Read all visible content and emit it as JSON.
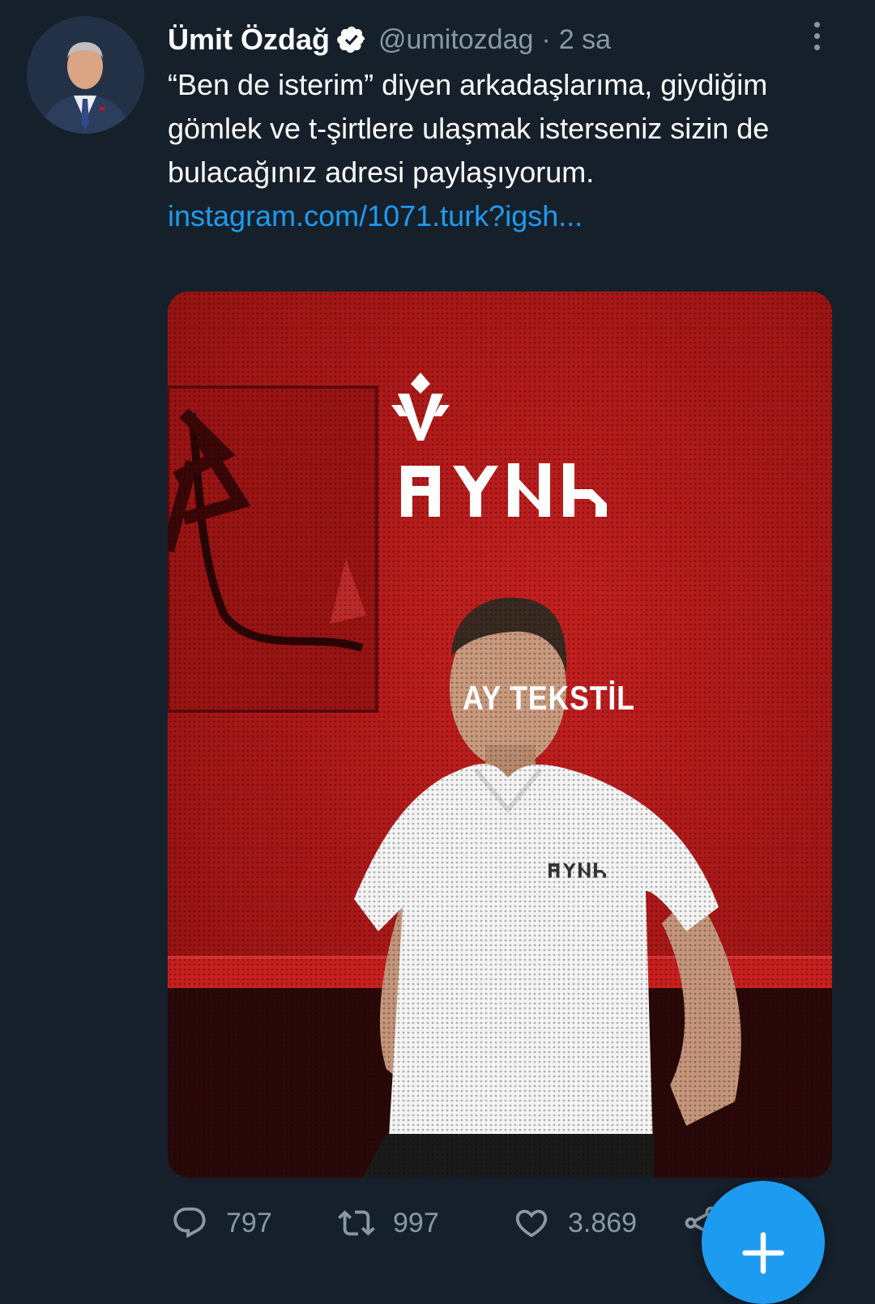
{
  "tweet": {
    "author": {
      "display_name": "Ümit Özdağ",
      "verified": true,
      "handle": "@umitozdag",
      "separator": "·",
      "time": "2 sa"
    },
    "text": "“Ben de isterim” diyen arkadaşlarıma, giydiğim gömlek ve t-şirtlere ulaşmak isterseniz sizin de bulacağınız adresi paylaşıyorum.",
    "link": "instagram.com/1071.turk?igsh...",
    "media": {
      "brand_name": "AY TEKSTİL",
      "brand_runes": "𐰀𐰖𐱃𐰚",
      "shirt_logo": "𐰀𐰖𐱃𐰚",
      "colors": {
        "background": "#b01818",
        "shirt": "#f4f4f4"
      }
    },
    "actions": {
      "reply_count": "797",
      "retweet_count": "997",
      "like_count": "3.869"
    }
  },
  "compose_button": {
    "icon": "plus-icon"
  },
  "colors": {
    "page_background": "#15202b",
    "secondary_text": "#8899a6",
    "accent": "#1d9bf0"
  }
}
